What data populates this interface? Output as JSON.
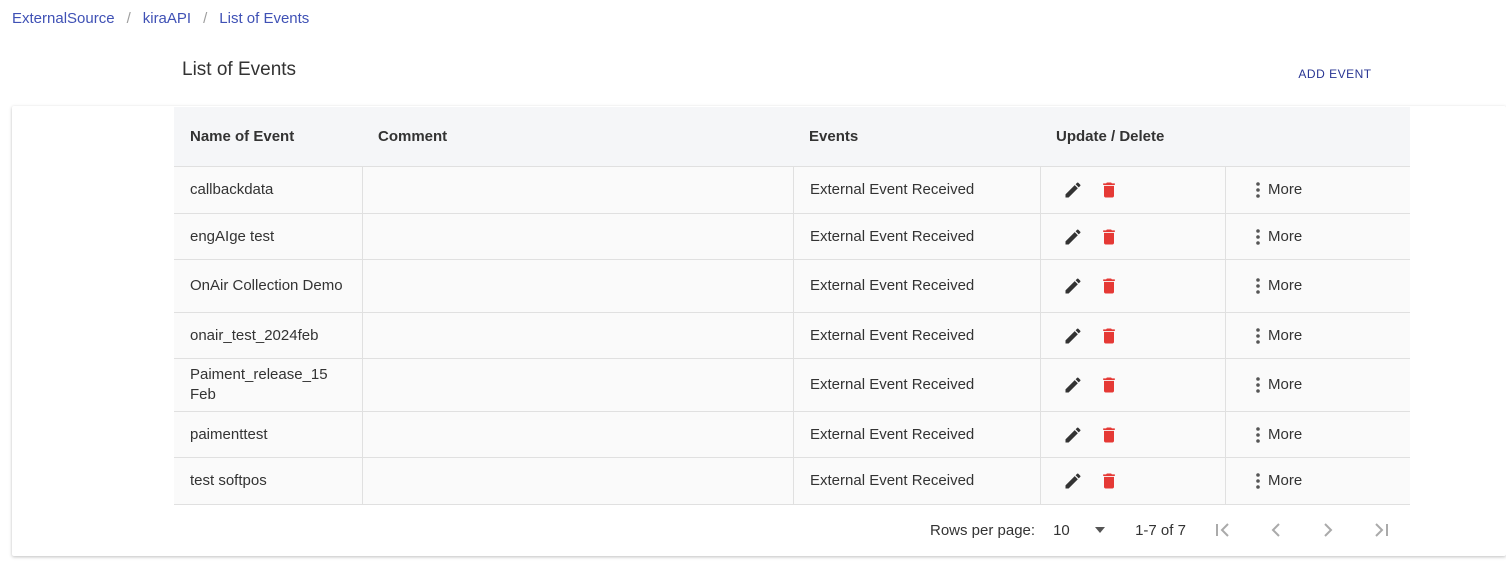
{
  "breadcrumb": [
    {
      "label": "ExternalSource"
    },
    {
      "label": "kiraAPI"
    },
    {
      "label": "List of Events"
    }
  ],
  "page_title": "List of Events",
  "add_button": "ADD EVENT",
  "columns": [
    "Name of Event",
    "Comment",
    "Events",
    "Update / Delete"
  ],
  "rows": [
    {
      "name": "callbackdata",
      "comment": "",
      "event": "External Event Received",
      "more": "More"
    },
    {
      "name": "engAIge test",
      "comment": "",
      "event": "External Event Received",
      "more": "More"
    },
    {
      "name": "OnAir Collection Demo",
      "comment": "",
      "event": "External Event Received",
      "more": "More"
    },
    {
      "name": "onair_test_2024feb",
      "comment": "",
      "event": "External Event Received",
      "more": "More"
    },
    {
      "name": "Paiment_release_15 Feb",
      "comment": "",
      "event": "External Event Received",
      "more": "More"
    },
    {
      "name": "paimenttest",
      "comment": "",
      "event": "External Event Received",
      "more": "More"
    },
    {
      "name": "test softpos",
      "comment": "",
      "event": "External Event Received",
      "more": "More"
    }
  ],
  "pagination": {
    "rows_per_page_label": "Rows per page:",
    "rows_per_page_value": "10",
    "range": "1-7 of 7"
  },
  "colors": {
    "link": "#3f51b5",
    "delete": "#e53935",
    "edit": "#333333"
  },
  "icons": [
    "edit-icon",
    "delete-icon",
    "more-vert-icon",
    "first-page-icon",
    "prev-page-icon",
    "next-page-icon",
    "last-page-icon"
  ]
}
